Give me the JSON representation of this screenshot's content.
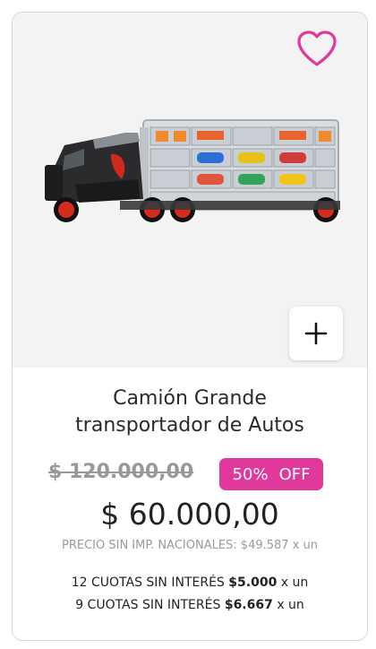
{
  "product": {
    "title_line1": "Camión Grande",
    "title_line2": "transportador de Autos",
    "old_price": "$ 120.000,00",
    "discount_percent": "50%",
    "discount_label": "OFF",
    "price": "$ 60.000,00",
    "tax_note": "PRECIO SIN IMP. NACIONALES: $49.587 x un",
    "installments": [
      {
        "text": "12 CUOTAS SIN INTERÉS",
        "amount": "$5.000",
        "suffix": "x un"
      },
      {
        "text": "9 CUOTAS SIN INTERÉS",
        "amount": "$6.667",
        "suffix": "x un"
      }
    ]
  },
  "icons": {
    "favorite": "heart-icon",
    "add": "plus-icon"
  },
  "colors": {
    "accent": "#e0399b",
    "background": "#f3f3f3"
  }
}
